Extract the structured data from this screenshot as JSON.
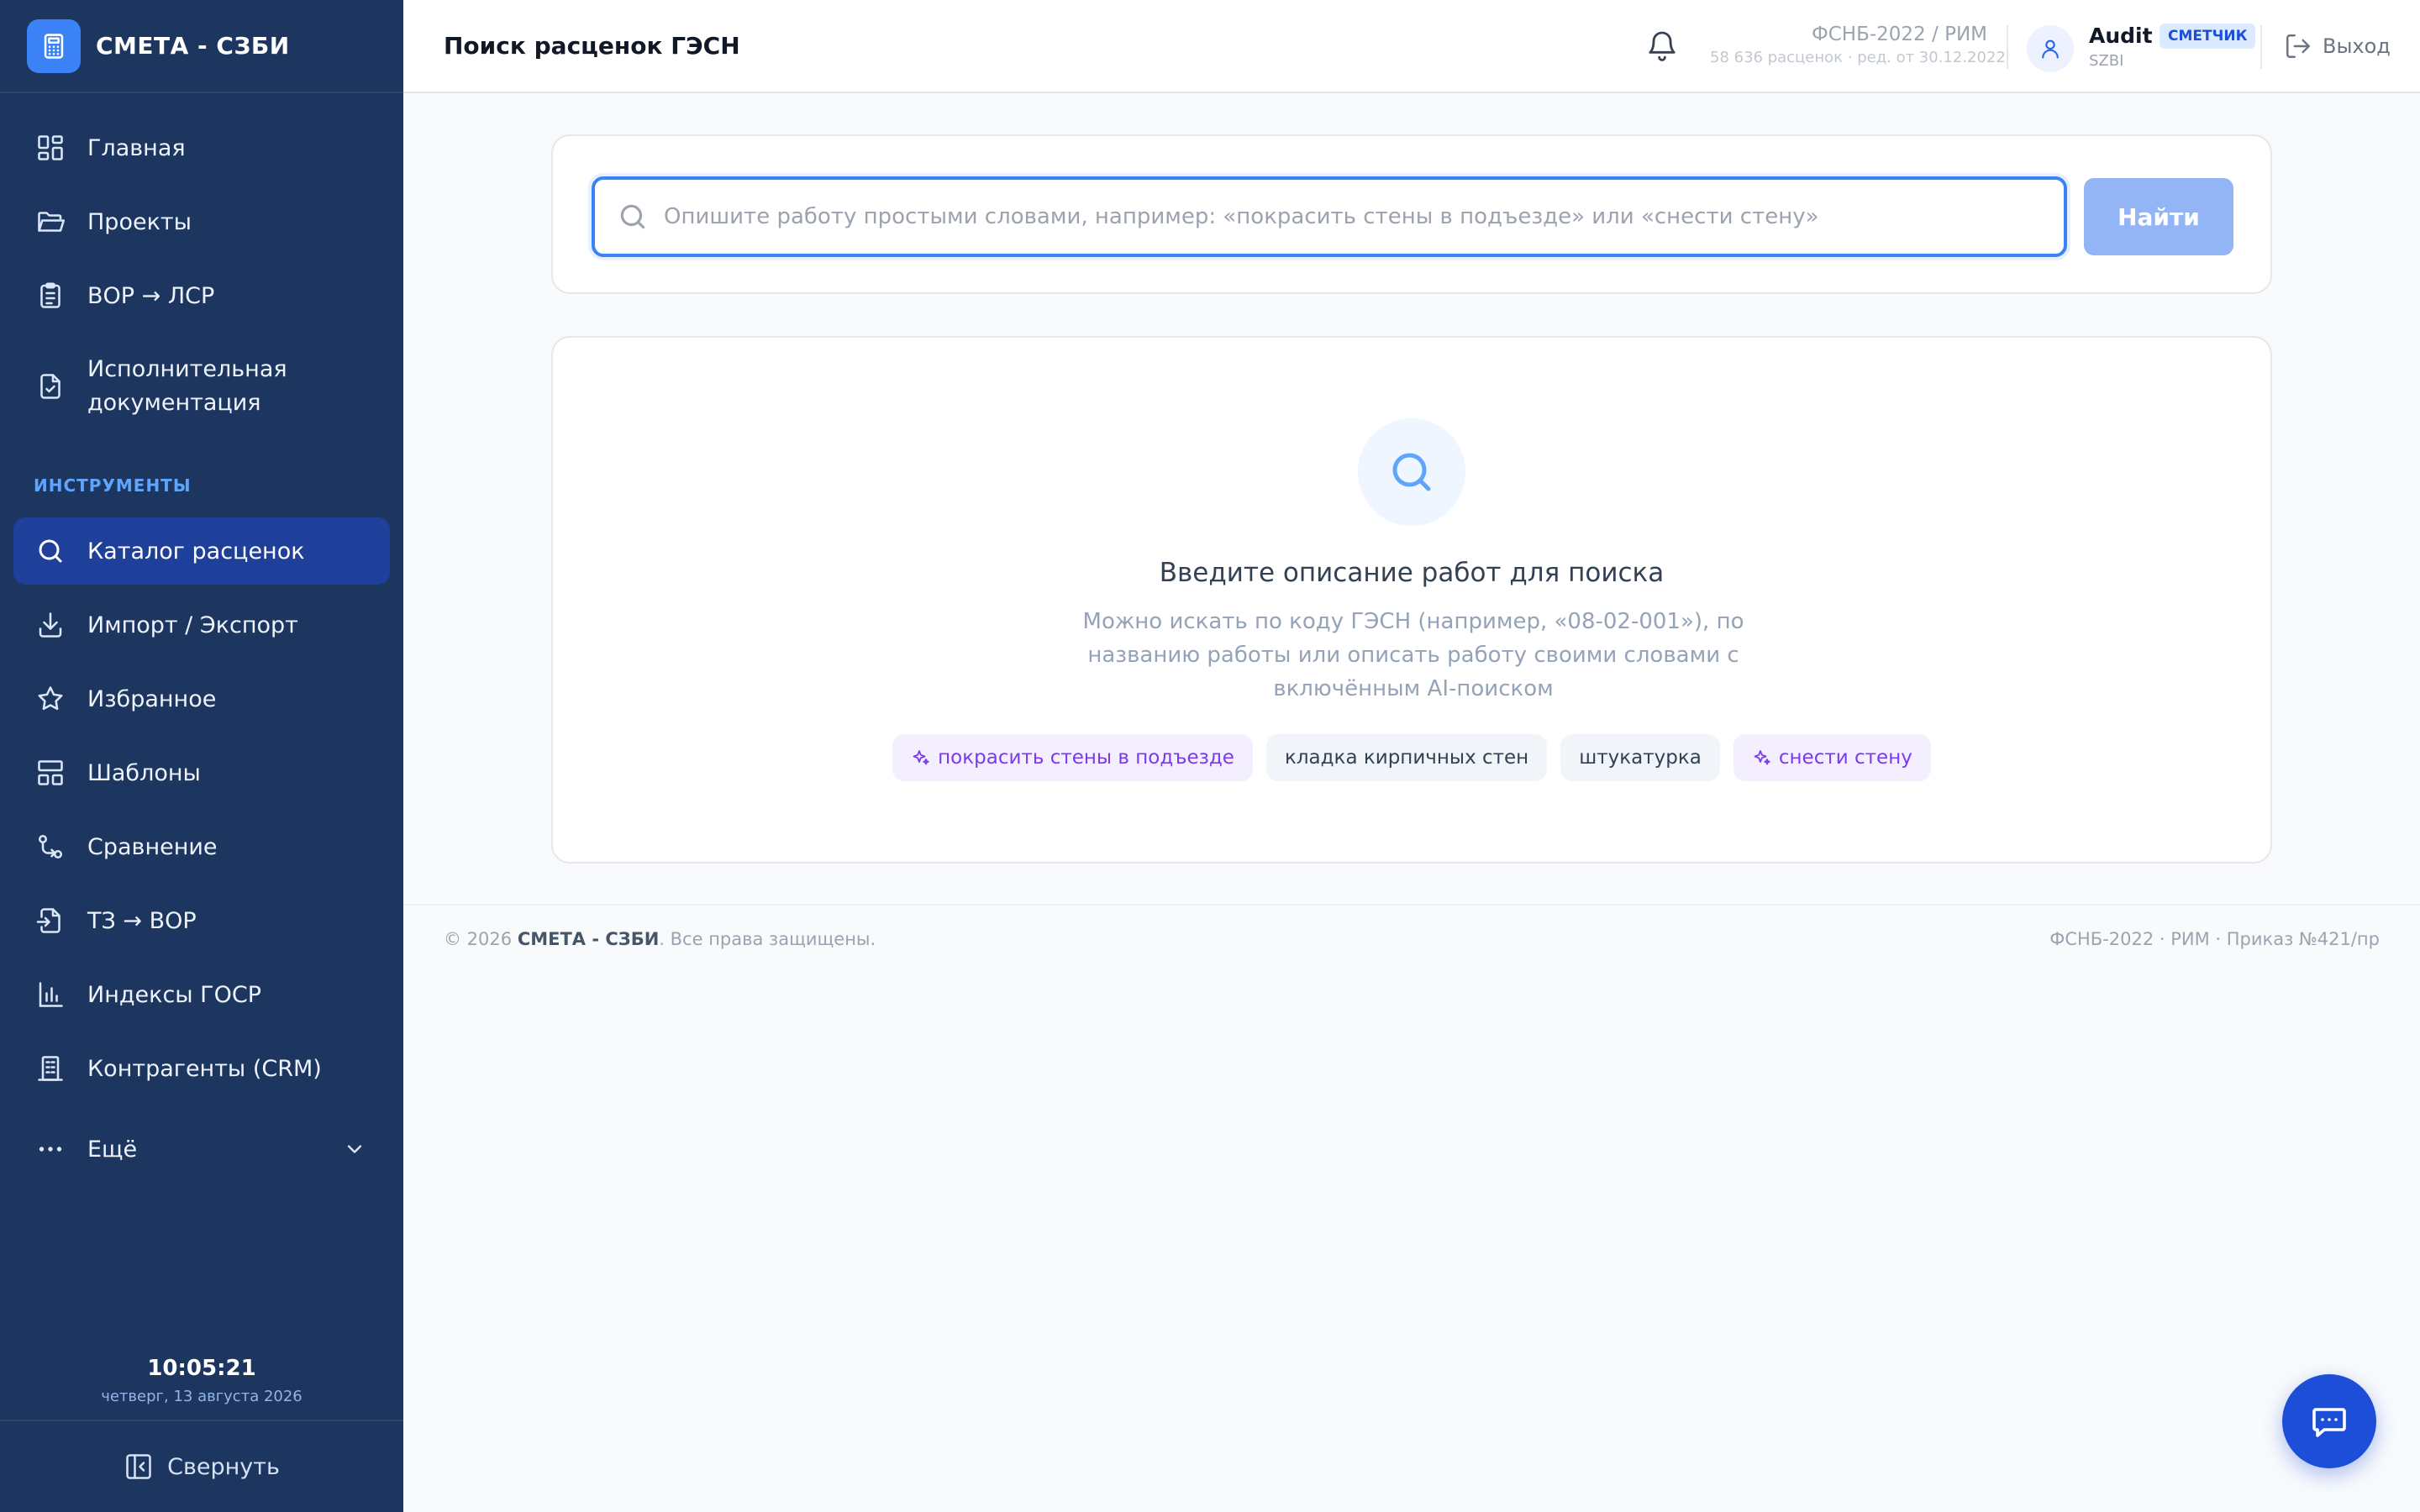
{
  "brand": {
    "name": "СМЕТА - СЗБИ"
  },
  "sidebar": {
    "items": [
      {
        "label": "Главная"
      },
      {
        "label": "Проекты"
      },
      {
        "label": "ВОР → ЛСР"
      },
      {
        "label": "Исполнительная документация"
      }
    ],
    "section_title": "ИНСТРУМЕНТЫ",
    "tools": [
      {
        "label": "Каталог расценок",
        "active": true
      },
      {
        "label": "Импорт / Экспорт"
      },
      {
        "label": "Избранное"
      },
      {
        "label": "Шаблоны"
      },
      {
        "label": "Сравнение"
      },
      {
        "label": "ТЗ → ВОР"
      },
      {
        "label": "Индексы ГОСР"
      },
      {
        "label": "Контрагенты (CRM)"
      }
    ],
    "more_label": "Ещё",
    "clock": {
      "time": "10:05:21",
      "date": "четверг, 13 августа 2026"
    },
    "collapse_label": "Свернуть"
  },
  "header": {
    "title": "Поиск расценок ГЭСН",
    "db_title": "ФСНБ-2022 / РИМ",
    "db_sub": "58 636 расценок · ред. от 30.12.2022",
    "user": {
      "name": "Audit",
      "role": "СМЕТЧИК",
      "org": "SZBI"
    },
    "logout_label": "Выход"
  },
  "search": {
    "placeholder": "Опишите работу простыми словами, например: «покрасить стены в подъезде» или «снести стену»",
    "value": "",
    "button_label": "Найти"
  },
  "empty_state": {
    "title": "Введите описание работ для поиска",
    "description": "Можно искать по коду ГЭСН (например, «08-02-001»), по названию работы или описать работу своими словами с включённым AI-поиском",
    "chips": [
      {
        "label": "покрасить стены в подъезде",
        "ai": true
      },
      {
        "label": "кладка кирпичных стен",
        "ai": false
      },
      {
        "label": "штукатурка",
        "ai": false
      },
      {
        "label": "снести стену",
        "ai": true
      }
    ]
  },
  "footer": {
    "copyright_prefix": "© 2026",
    "brand": "СМЕТА - СЗБИ",
    "rights": ". Все права защищены.",
    "right_text": "ФСНБ-2022 · РИМ · Приказ №421/пр"
  },
  "colors": {
    "sidebar_bg": "#1c3660",
    "active_nav": "#1e3f9a",
    "accent": "#3b82f6",
    "ai_chip_text": "#7c3aed",
    "chat_button": "#1d4ed8"
  }
}
